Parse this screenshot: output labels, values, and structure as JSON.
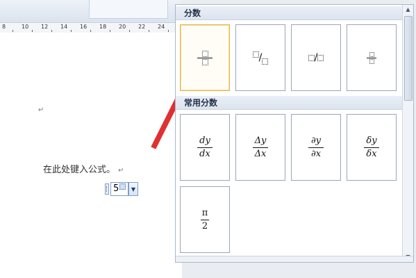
{
  "ruler": {
    "numbers": [
      "8",
      "10",
      "12",
      "14",
      "16",
      "18",
      "20",
      "22",
      "24"
    ]
  },
  "document": {
    "formula_placeholder": "在此处键入公式。",
    "paragraph_mark": "↵",
    "equation_value": "5"
  },
  "gallery": {
    "section1_title": "分数",
    "section2_title": "常用分数",
    "common": [
      {
        "num": "dy",
        "den": "dx"
      },
      {
        "num": "Δy",
        "den": "Δx"
      },
      {
        "num": "∂y",
        "den": "∂x"
      },
      {
        "num": "δy",
        "den": "δx"
      },
      {
        "num": "π",
        "den": "2"
      }
    ],
    "slash": "/"
  },
  "icons": {
    "dropdown": "chevron-down-icon",
    "scroll_up": "triangle-up-icon",
    "scroll_down": "triangle-down-icon",
    "arrow": "red-arrow"
  },
  "colors": {
    "arrow": "#e03030",
    "selected_border": "#e6b54a"
  }
}
